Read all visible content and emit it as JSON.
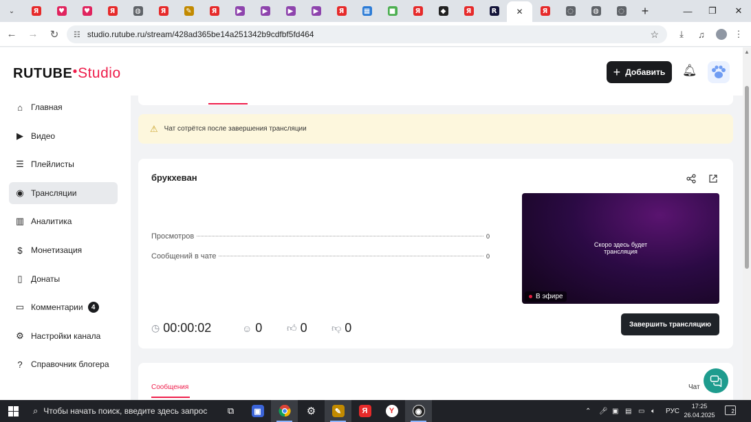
{
  "browser": {
    "url": "studio.rutube.ru/stream/428ad365be14a251342b9cdfbf5fd464",
    "tabs": [
      {
        "icon": "yandex-icon",
        "label": "Я",
        "color": "#e62a2a"
      },
      {
        "icon": "heart-icon",
        "label": "♥",
        "color": "#e0245e"
      },
      {
        "icon": "heart-icon",
        "label": "♥",
        "color": "#e0245e"
      },
      {
        "icon": "yandex-icon",
        "label": "Я",
        "color": "#e62a2a"
      },
      {
        "icon": "globe-icon",
        "label": "◍",
        "color": "#5f6368"
      },
      {
        "icon": "yandex-icon",
        "label": "Я",
        "color": "#e62a2a"
      },
      {
        "icon": "pen-icon",
        "label": "✎",
        "color": "#c28a00"
      },
      {
        "icon": "yandex-icon",
        "label": "Я",
        "color": "#e62a2a"
      },
      {
        "icon": "play-icon",
        "label": "▶",
        "color": "#8e44ad"
      },
      {
        "icon": "play-icon",
        "label": "▶",
        "color": "#8e44ad"
      },
      {
        "icon": "play-icon",
        "label": "▶",
        "color": "#8e44ad"
      },
      {
        "icon": "play-icon",
        "label": "▶",
        "color": "#8e44ad"
      },
      {
        "icon": "yandex-icon",
        "label": "Я",
        "color": "#e62a2a"
      },
      {
        "icon": "table-icon",
        "label": "▦",
        "color": "#2b7bd6"
      },
      {
        "icon": "microsoft-icon",
        "label": "■",
        "color": "#4caf50"
      },
      {
        "icon": "yandex-icon",
        "label": "Я",
        "color": "#e62a2a"
      },
      {
        "icon": "roblox-icon",
        "label": "◆",
        "color": "#222222"
      },
      {
        "icon": "yandex-icon",
        "label": "Я",
        "color": "#e62a2a"
      },
      {
        "icon": "rutube-icon",
        "label": "R",
        "color": "#14153a"
      },
      {
        "icon": "yandex-icon",
        "label": "Я",
        "color": "#e62a2a"
      },
      {
        "icon": "circle-icon",
        "label": "◌",
        "color": "#5f6368"
      },
      {
        "icon": "globe-icon",
        "label": "◍",
        "color": "#5f6368"
      },
      {
        "icon": "circle-icon",
        "label": "◌",
        "color": "#5f6368"
      }
    ]
  },
  "header": {
    "logo_main": "RUTUBE",
    "logo_sub": "Studio",
    "add_label": "Добавить"
  },
  "sidebar": {
    "items": [
      {
        "label": "Главная",
        "icon": "home-icon",
        "glyph": "⌂"
      },
      {
        "label": "Видео",
        "icon": "video-icon",
        "glyph": "▶"
      },
      {
        "label": "Плейлисты",
        "icon": "playlist-icon",
        "glyph": "☰"
      },
      {
        "label": "Трансляции",
        "icon": "broadcast-icon",
        "glyph": "◉"
      },
      {
        "label": "Аналитика",
        "icon": "analytics-icon",
        "glyph": "▥"
      },
      {
        "label": "Монетизация",
        "icon": "monetization-icon",
        "glyph": "$"
      },
      {
        "label": "Донаты",
        "icon": "donate-icon",
        "glyph": "▯"
      },
      {
        "label": "Комментарии",
        "icon": "comments-icon",
        "glyph": "▭",
        "badge": "4"
      },
      {
        "label": "Настройки канала",
        "icon": "settings-icon",
        "glyph": "⚙"
      },
      {
        "label": "Справочник блогера",
        "icon": "help-icon",
        "glyph": "?"
      }
    ]
  },
  "notice": {
    "text": "Чат сотрётся после завершения трансляции"
  },
  "stream": {
    "title": "брукхеван",
    "stats": [
      {
        "label": "Просмотров",
        "value": "0"
      },
      {
        "label": "Сообщений в чате",
        "value": "0"
      }
    ],
    "preview_text_line1": "Скоро здесь будет",
    "preview_text_line2": "трансляция",
    "live_label": "В эфире",
    "timer": "00:00:02",
    "viewers": "0",
    "likes": "0",
    "dislikes": "0",
    "end_label": "Завершить трансляцию"
  },
  "chat_panel": {
    "tab_messages": "Сообщения",
    "tab_chat": "Чат"
  },
  "taskbar": {
    "search_placeholder": "Чтобы начать поиск, введите здесь запрос",
    "lang": "РУС",
    "time": "17:25",
    "date": "26.04.2025",
    "notifications": "2"
  }
}
